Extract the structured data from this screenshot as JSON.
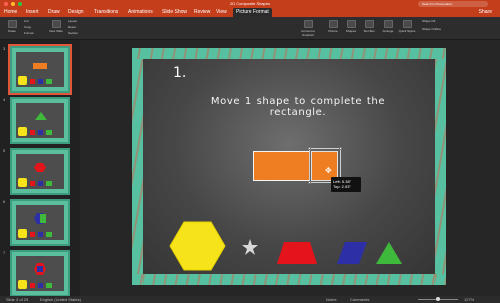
{
  "window": {
    "title": "2D Composite Shapes",
    "search_placeholder": "Search in Presentation"
  },
  "ribbon_tabs": [
    "Home",
    "Insert",
    "Draw",
    "Design",
    "Transitions",
    "Animations",
    "Slide Show",
    "Review",
    "View",
    "Picture Format"
  ],
  "active_tab": "Picture Format",
  "share_label": "Share",
  "ribbon": {
    "paste": "Paste",
    "cut": "Cut",
    "copy": "Copy",
    "format": "Format",
    "new_slide": "New Slide",
    "layout": "Layout",
    "reset": "Reset",
    "section": "Section",
    "convert_smartart": "Convert to SmartArt",
    "picture": "Picture",
    "shapes": "Shapes",
    "text_box": "Text Box",
    "arrange": "Arrange",
    "quick_styles": "Quick Styles",
    "shape_fill": "Shape Fill",
    "shape_outline": "Shape Outline"
  },
  "slides": [
    {
      "number": "3",
      "selected": true
    },
    {
      "number": "4",
      "selected": false
    },
    {
      "number": "5",
      "selected": false
    },
    {
      "number": "6",
      "selected": false
    },
    {
      "number": "7",
      "selected": false
    }
  ],
  "slide": {
    "number": "1.",
    "instruction": "Move 1 shape to complete the rectangle.",
    "position_tooltip": {
      "left": "Left: 5.36\"",
      "top": "Top: 2.93\""
    },
    "colors": {
      "frame": "#57c0a0",
      "orange": "#ef7d22",
      "yellow": "#f7e319",
      "red": "#e3151b",
      "blue": "#2c2fa5",
      "green": "#3fb93b",
      "star": "#d8d8d8"
    }
  },
  "statusbar": {
    "slide_counter": "Slide 3 of 29",
    "language": "English (United States)",
    "notes": "Notes",
    "comments": "Comments",
    "zoom": "127%"
  }
}
